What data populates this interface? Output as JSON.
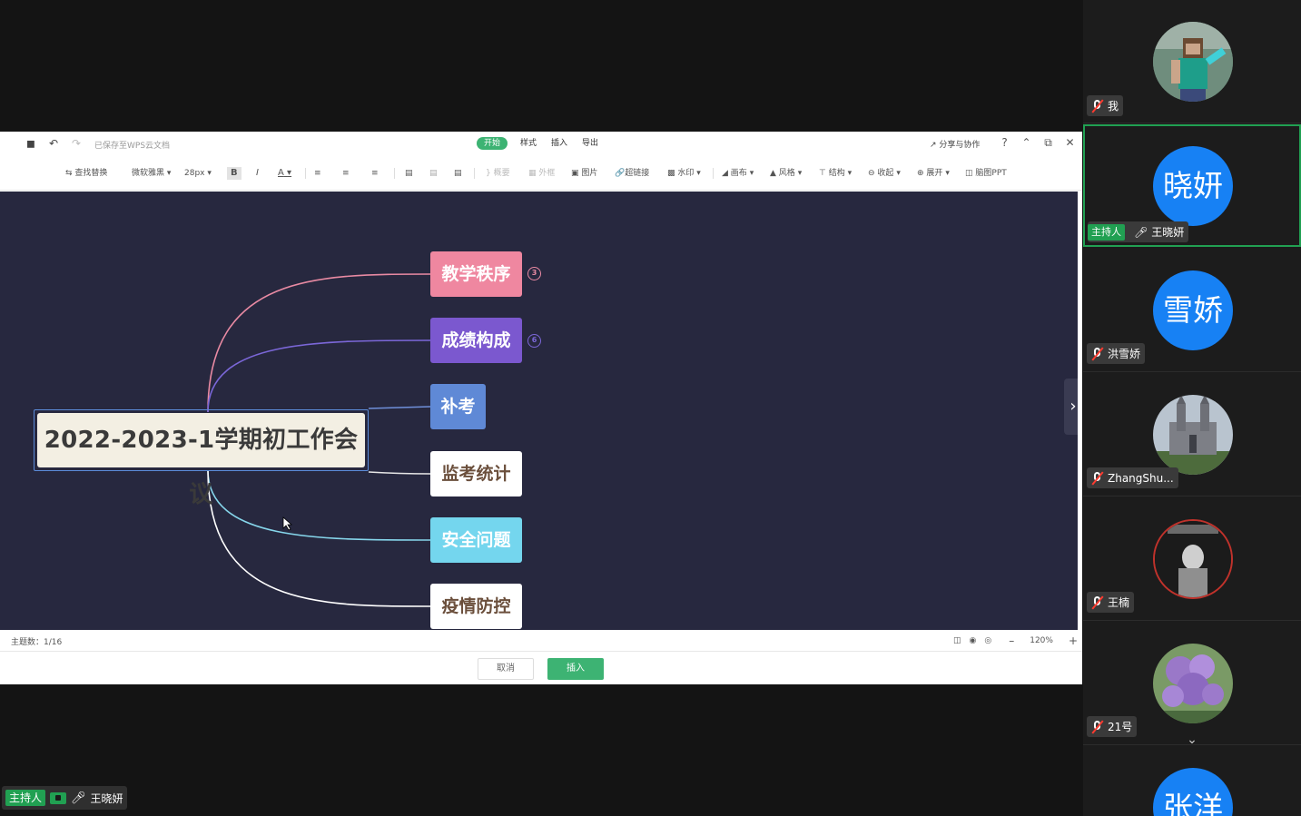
{
  "titlebar": {
    "save_status": "已保存至WPS云文档",
    "tabs": [
      "开始",
      "样式",
      "插入",
      "导出"
    ],
    "active_tab": "开始",
    "share": "分享与协作"
  },
  "toolbar": {
    "find_replace": "查找替换",
    "font": "微软雅黑",
    "font_size": "28px",
    "bold": "B",
    "italic": "I",
    "font_color": "A",
    "summary": "概要",
    "frame": "外框",
    "image": "图片",
    "hyperlink": "超链接",
    "watermark": "水印",
    "canvas": "画布",
    "style": "风格",
    "structure": "结构",
    "collapse": "收起",
    "expand": "展开",
    "to_ppt": "脑图PPT"
  },
  "mindmap": {
    "root": "2022-2023-1学期初工作会议",
    "topics": [
      {
        "label": "教学秩序",
        "bg": "#ef87a0",
        "fg": "#ffffff",
        "line": "#e98aa3",
        "badge": "3",
        "badge_color": "#e98aa3"
      },
      {
        "label": "成绩构成",
        "bg": "#7b58cf",
        "fg": "#ffffff",
        "line": "#7b67d8",
        "badge": "6",
        "badge_color": "#7b67d8"
      },
      {
        "label": "补考",
        "bg": "#5f89d6",
        "fg": "#ffffff",
        "line": "#6f8fd9"
      },
      {
        "label": "监考统计",
        "bg": "#ffffff",
        "fg": "#6b4f3c",
        "line": "#e7e7e7"
      },
      {
        "label": "安全问题",
        "bg": "#74d6ee",
        "fg": "#ffffff",
        "line": "#86d6eb"
      },
      {
        "label": "疫情防控",
        "bg": "#ffffff",
        "fg": "#6b4f3c",
        "line": "#ffffff"
      }
    ]
  },
  "statusbar": {
    "topic_count": "主题数：1/16",
    "zoom": "120%"
  },
  "footer": {
    "cancel": "取消",
    "insert": "插入"
  },
  "speaker": {
    "host_tag": "主持人",
    "name": "王晓妍"
  },
  "participants": [
    {
      "name": "我",
      "avatar_text": "",
      "muted": true
    },
    {
      "name": "王晓妍",
      "avatar_text": "晓妍",
      "muted": false,
      "host": "主持人"
    },
    {
      "name": "洪雪娇",
      "avatar_text": "雪娇",
      "muted": true
    },
    {
      "name": "ZhangShu...",
      "avatar_text": "",
      "muted": true
    },
    {
      "name": "王楠",
      "avatar_text": "",
      "muted": true
    },
    {
      "name": "21号",
      "avatar_text": "",
      "muted": true
    },
    {
      "name": "",
      "avatar_text": "张洋",
      "muted": true
    }
  ],
  "colors": {
    "canvas_bg": "#27283f",
    "accent_green": "#3db373",
    "host_green": "#21a052",
    "avatar_blue": "#1781f4"
  }
}
